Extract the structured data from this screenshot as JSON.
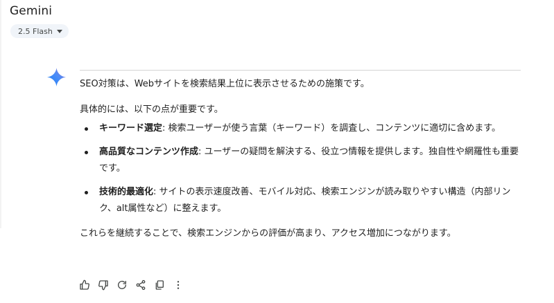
{
  "header": {
    "app_title": "Gemini",
    "model_selector": "2.5 Flash"
  },
  "response": {
    "intro": "SEO対策は、Webサイトを検索結果上位に表示させるための施策です。",
    "lead": "具体的には、以下の点が重要です。",
    "points": [
      {
        "term": "キーワード選定",
        "text": ": 検索ユーザーが使う言葉（キーワード）を調査し、コンテンツに適切に含めます。"
      },
      {
        "term": "高品質なコンテンツ作成",
        "text": ": ユーザーの疑問を解決する、役立つ情報を提供します。独自性や網羅性も重要です。"
      },
      {
        "term": "技術的最適化",
        "text": ": サイトの表示速度改善、モバイル対応、検索エンジンが読み取りやすい構造（内部リンク、alt属性など）に整えます。"
      }
    ],
    "closing": "これらを継続することで、検索エンジンからの評価が高まり、アクセス増加につながります。"
  },
  "actions": [
    "thumb-up-icon",
    "thumb-down-icon",
    "regenerate-icon",
    "share-icon",
    "copy-icon",
    "more-vert-icon"
  ],
  "colors": {
    "chip_bg": "#f0f4f9",
    "text": "#1f1f1f",
    "icon": "#444746",
    "sparkle_blue": "#4285f4"
  }
}
